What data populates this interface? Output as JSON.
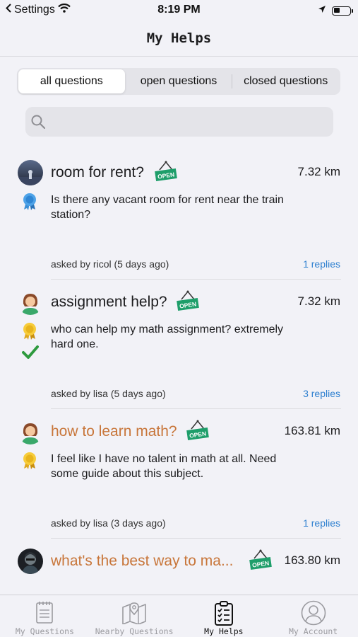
{
  "status_bar": {
    "back_label": "Settings",
    "time": "8:19 PM"
  },
  "nav": {
    "title": "My Helps"
  },
  "segments": [
    {
      "label": "all questions",
      "active": true
    },
    {
      "label": "open questions",
      "active": false
    },
    {
      "label": "closed questions",
      "active": false
    }
  ],
  "search": {
    "placeholder": "",
    "value": ""
  },
  "open_tag_label": "OPEN",
  "questions": [
    {
      "title": "room for rent?",
      "distance": "7.32 km",
      "description": "Is there any vacant room for rent near the train station?",
      "asked": "asked by ricol (5 days ago)",
      "replies": "1 replies",
      "badge": "blue-ribbon"
    },
    {
      "title": "assignment help?",
      "distance": "7.32 km",
      "description": "who can help my math assignment? extremely hard one.",
      "asked": "asked by lisa (5 days ago)",
      "replies": "3 replies",
      "badge": "gold-ribbon",
      "solved": true
    },
    {
      "title": "how to learn math?",
      "distance": "163.81 km",
      "description": "I feel like I have no talent in math at all. Need some guide about this subject.",
      "asked": "asked by lisa (3 days ago)",
      "replies": "1 replies",
      "badge": "gold-ribbon"
    },
    {
      "title": "what's the best way to ma...",
      "distance": "163.80 km"
    }
  ],
  "tabs": [
    {
      "label": "My Questions",
      "icon": "notepad-icon",
      "active": false
    },
    {
      "label": "Nearby Questions",
      "icon": "map-icon",
      "active": false
    },
    {
      "label": "My Helps",
      "icon": "clipboard-check-icon",
      "active": true
    },
    {
      "label": "My Account",
      "icon": "account-icon",
      "active": false
    }
  ],
  "colors": {
    "link": "#2f80d0",
    "highlight_title": "#c8763a",
    "open_tag": "#1e9e6a",
    "check": "#2e9a3e"
  }
}
